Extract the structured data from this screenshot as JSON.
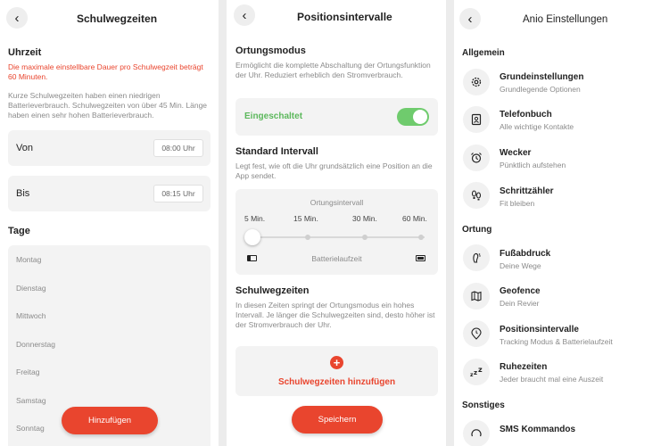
{
  "school": {
    "title": "Schulwegzeiten",
    "uhrzeit_heading": "Uhrzeit",
    "warning": "Die maximale einstellbare Dauer pro Schulwegzeit beträgt 60 Minuten.",
    "info": "Kurze Schulwegzeiten haben einen niedrigen Batterieverbrauch. Schulwegzeiten von über 45 Min. Länge haben einen sehr hohen Batterieverbrauch.",
    "von_label": "Von",
    "von_value": "08:00 Uhr",
    "bis_label": "Bis",
    "bis_value": "08:15 Uhr",
    "tage_heading": "Tage",
    "days": [
      "Montag",
      "Dienstag",
      "Mittwoch",
      "Donnerstag",
      "Freitag",
      "Samstag",
      "Sonntag"
    ],
    "add_button": "Hinzufügen"
  },
  "intervals": {
    "title": "Positionsintervalle",
    "mode_heading": "Ortungsmodus",
    "mode_desc": "Ermöglicht die komplette Abschaltung der Ortungsfunktion der Uhr. Reduziert erheblich den Stromverbrauch.",
    "mode_status": "Eingeschaltet",
    "mode_on": true,
    "standard_heading": "Standard Intervall",
    "standard_desc": "Legt fest, wie oft die Uhr grundsätzlich eine Position an die App sendet.",
    "slider_label": "Ortungsintervall",
    "slider_ticks": [
      "5 Min.",
      "15 Min.",
      "30 Min.",
      "60 Min."
    ],
    "slider_selected_index": 0,
    "battery_label": "Batterielaufzeit",
    "school_heading": "Schulwegzeiten",
    "school_desc": "In diesen Zeiten springt der Ortungsmodus ein hohes Intervall. Je länger die Schulwegzeiten sind, desto höher ist der Stromverbrauch der Uhr.",
    "add_school": "Schulwegzeiten hinzufügen",
    "save_button": "Speichern"
  },
  "settings": {
    "title": "Anio Einstellungen",
    "sections": [
      {
        "label": "Allgemein"
      },
      {
        "label": "Ortung"
      },
      {
        "label": "Sonstiges"
      }
    ],
    "items": [
      {
        "title": "Grundeinstellungen",
        "sub": "Grundlegende Optionen",
        "icon": "gear-icon"
      },
      {
        "title": "Telefonbuch",
        "sub": "Alle wichtige Kontakte",
        "icon": "contacts-icon"
      },
      {
        "title": "Wecker",
        "sub": "Pünktlich aufstehen",
        "icon": "alarm-icon"
      },
      {
        "title": "Schrittzähler",
        "sub": "Fit bleiben",
        "icon": "footsteps-icon"
      },
      {
        "title": "Fußabdruck",
        "sub": "Deine Wege",
        "icon": "footprint-icon"
      },
      {
        "title": "Geofence",
        "sub": "Dein Revier",
        "icon": "map-icon"
      },
      {
        "title": "Positionsintervalle",
        "sub": "Tracking Modus & Batterielaufzeit",
        "icon": "clock-location-icon"
      },
      {
        "title": "Ruhezeiten",
        "sub": "Jeder braucht mal eine Auszeit",
        "icon": "sleep-icon"
      },
      {
        "title": "SMS Kommandos",
        "sub": "",
        "icon": "sms-icon"
      }
    ]
  },
  "colors": {
    "accent": "#e9452e",
    "toggle_on": "#6fcb6d",
    "on_text": "#5cb85c"
  }
}
